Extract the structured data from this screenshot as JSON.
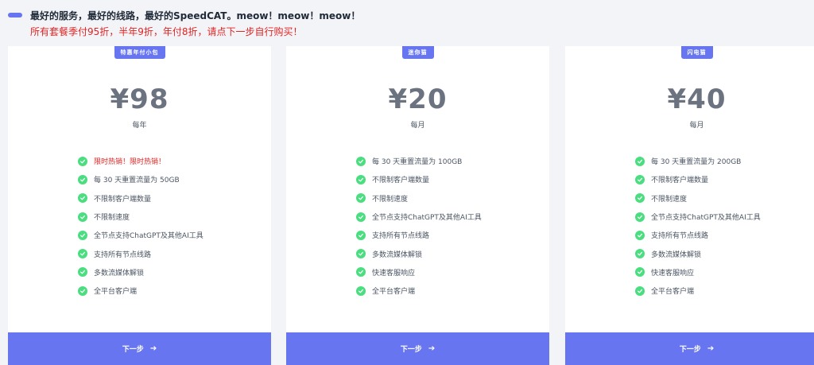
{
  "banner": {
    "title": "最好的服务，最好的线路，最好的SpeedCAT。meow！meow！meow！",
    "promo": "所有套餐季付95折，半年9折，年付8折，请点下一步自行购买！"
  },
  "plans": [
    {
      "badge": "特惠年付小包",
      "price": "¥98",
      "period": "每年",
      "features": [
        "限时热销！限时热销！",
        "每 30 天重置流量为 50GB",
        "不限制客户端数量",
        "不限制速度",
        "全节点支持ChatGPT及其他AI工具",
        "支持所有节点线路",
        "多数流媒体解锁",
        "全平台客户端"
      ],
      "button": "下一步"
    },
    {
      "badge": "迷你猫",
      "price": "¥20",
      "period": "每月",
      "features": [
        "每 30 天重置流量为 100GB",
        "不限制客户端数量",
        "不限制速度",
        "全节点支持ChatGPT及其他AI工具",
        "支持所有节点线路",
        "多数流媒体解锁",
        "快速客服响应",
        "全平台客户端"
      ],
      "button": "下一步"
    },
    {
      "badge": "闪电猫",
      "price": "¥40",
      "period": "每月",
      "features": [
        "每 30 天重置流量为 200GB",
        "不限制客户端数量",
        "不限制速度",
        "全节点支持ChatGPT及其他AI工具",
        "支持所有节点线路",
        "多数流媒体解锁",
        "快速客服响应",
        "全平台客户端"
      ],
      "button": "下一步"
    }
  ],
  "icons": {
    "feature": "check-circle-icon",
    "button": "arrow-right-icon"
  },
  "colors": {
    "accent": "#6776f0",
    "check": "#4ade80",
    "promo": "#e02424"
  }
}
